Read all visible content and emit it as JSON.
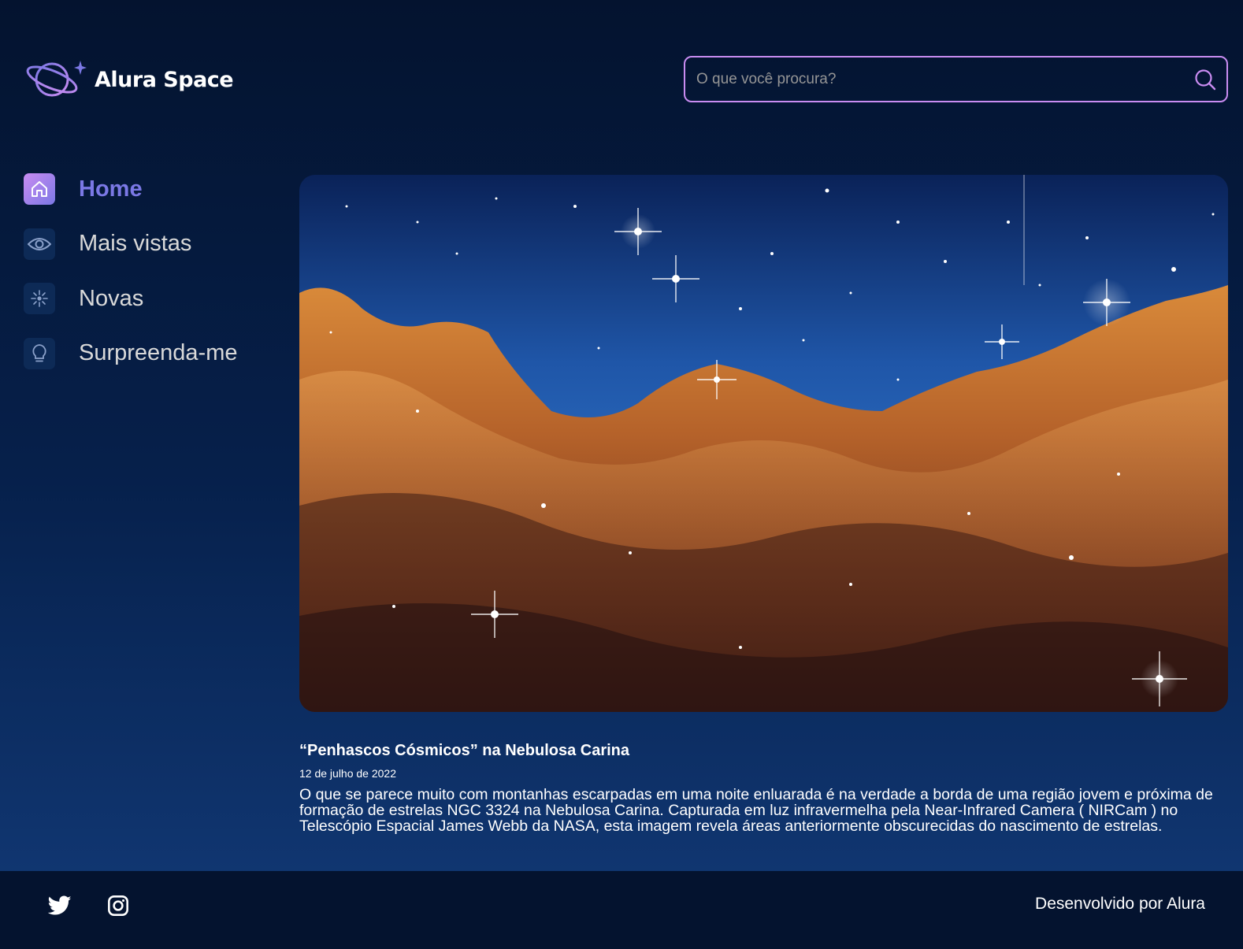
{
  "header": {
    "logo_text": "Alura Space",
    "search": {
      "placeholder": "O que você procura?",
      "value": ""
    }
  },
  "sidebar": {
    "items": [
      {
        "label": "Home",
        "icon": "home-icon",
        "active": true
      },
      {
        "label": "Mais vistas",
        "icon": "eye-icon",
        "active": false
      },
      {
        "label": "Novas",
        "icon": "sparkle-icon",
        "active": false
      },
      {
        "label": "Surpreenda-me",
        "icon": "lightbulb-icon",
        "active": false
      }
    ]
  },
  "main": {
    "image_subject": "Cosmic Cliffs nebula photograph",
    "title": "“Penhascos Cósmicos” na Nebulosa Carina",
    "date": "12 de julho de 2022",
    "description": "O que se parece muito com montanhas escarpadas em uma noite enluarada é na verdade a borda de uma região jovem e próxima de formação de estrelas NGC 3324 na Nebulosa Carina. Capturada em luz infravermelha pela Near-Infrared Camera ( NIRCam ) no Telescópio Espacial James Webb da NASA, esta imagem revela áreas anteriormente obscurecidas do nascimento de estrelas."
  },
  "footer": {
    "social": [
      {
        "icon": "twitter-icon"
      },
      {
        "icon": "instagram-icon"
      }
    ],
    "credit": "Desenvolvido por Alura"
  },
  "colors": {
    "accent_purple": "#c98cf1",
    "accent_indigo": "#7b78e5",
    "background_dark": "#04132f",
    "text_light": "#d9d9d9"
  }
}
